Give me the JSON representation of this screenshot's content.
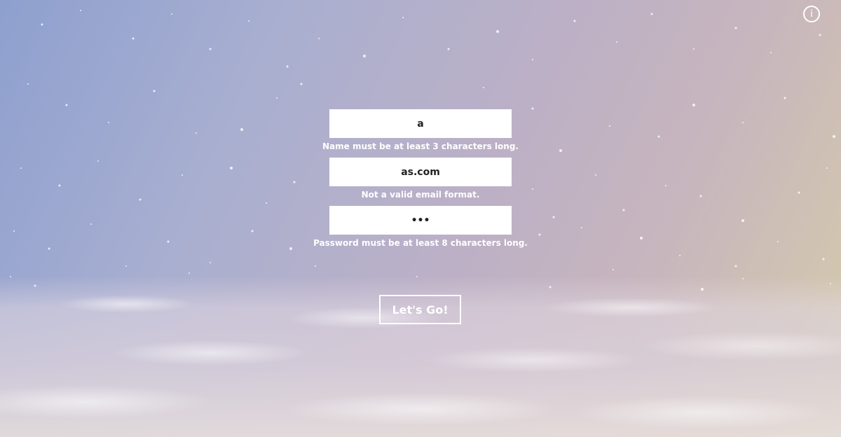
{
  "info": {
    "icon": "info-icon",
    "glyph": "i"
  },
  "form": {
    "name": {
      "value": "a",
      "error": "Name must be at least 3 characters long."
    },
    "email": {
      "value": "as.com",
      "error": "Not a valid email format."
    },
    "password": {
      "value": "abc",
      "error": "Password must be at least 8 characters long."
    },
    "submit_label": "Let's Go!"
  },
  "colors": {
    "sky_left": "#8ea0cf",
    "sky_right": "#d6cca9",
    "field_bg": "#ffffff",
    "text_white": "#ffffff"
  }
}
